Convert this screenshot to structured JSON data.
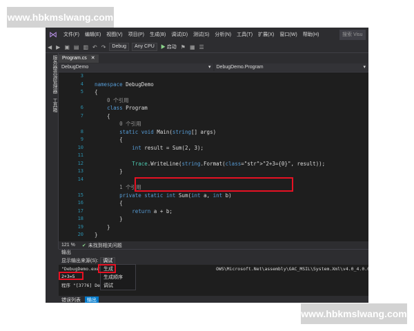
{
  "watermark": {
    "text": "www.hbkmslwang.com"
  },
  "menu": [
    "文件(F)",
    "编辑(E)",
    "视图(V)",
    "项目(P)",
    "生成(B)",
    "调试(D)",
    "测试(S)",
    "分析(N)",
    "工具(T)",
    "扩展(X)",
    "窗口(W)",
    "帮助(H)"
  ],
  "search_placeholder": "搜索 Visu",
  "toolbar": {
    "config": "Debug",
    "platform": "Any CPU",
    "start": "启动"
  },
  "left_tabs": [
    "服务器资源管理器",
    "工具箱"
  ],
  "editor": {
    "tab_name": "Program.cs",
    "nav_left": "DebugDemo",
    "nav_right": "DebugDemo.Program",
    "zoom": "121 %",
    "status": "未找到相关问题"
  },
  "code_lines": [
    {
      "n": "3",
      "text": ""
    },
    {
      "n": "4",
      "text": "namespace DebugDemo"
    },
    {
      "n": "5",
      "text": "{"
    },
    {
      "n": "",
      "text": "    0 个引用"
    },
    {
      "n": "6",
      "text": "    class Program"
    },
    {
      "n": "7",
      "text": "    {"
    },
    {
      "n": "",
      "text": "        0 个引用"
    },
    {
      "n": "8",
      "text": "        static void Main(string[] args)"
    },
    {
      "n": "9",
      "text": "        {"
    },
    {
      "n": "10",
      "text": "            int result = Sum(2, 3);"
    },
    {
      "n": "11",
      "text": ""
    },
    {
      "n": "12",
      "text": "            Trace.WriteLine(string.Format(\"2+3={0}\", result));"
    },
    {
      "n": "13",
      "text": "        }"
    },
    {
      "n": "14",
      "text": ""
    },
    {
      "n": "",
      "text": "        1 个引用"
    },
    {
      "n": "15",
      "text": "        private static int Sum(int a, int b)"
    },
    {
      "n": "16",
      "text": "        {"
    },
    {
      "n": "17",
      "text": "            return a + b;"
    },
    {
      "n": "18",
      "text": "        }"
    },
    {
      "n": "19",
      "text": "    }"
    },
    {
      "n": "20",
      "text": "}"
    }
  ],
  "output": {
    "title": "输出",
    "source_label": "显示输出来源(S):",
    "source_value": "调试",
    "lines": [
      {
        "text": "\"DebugDemo.exe\""
      },
      {
        "text": "2+3=5"
      },
      {
        "text": "程序 \"[3776] Deb"
      }
    ],
    "right_text": "OWS\\Microsoft.Net\\assembly\\GAC_MSIL\\System.Xml\\v4.0_4.0.0.0__b77a",
    "dropdown": [
      "生成",
      "生成顺序",
      "调试"
    ]
  },
  "bottom_tabs": [
    "错误列表",
    "输出"
  ]
}
